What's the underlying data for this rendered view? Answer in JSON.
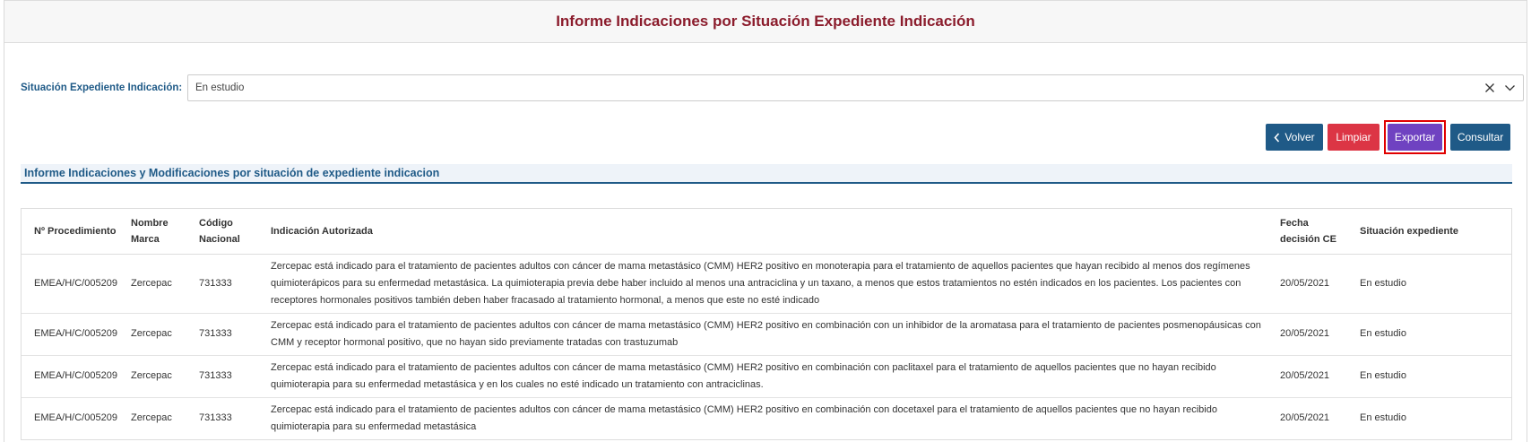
{
  "header": {
    "title": "Informe Indicaciones por Situación Expediente Indicación"
  },
  "filter": {
    "label": "Situación Expediente Indicación:",
    "value": "En estudio",
    "clear_icon": "close-icon",
    "dropdown_icon": "chevron-down-icon"
  },
  "buttons": {
    "volver": "Volver",
    "limpiar": "Limpiar",
    "exportar": "Exportar",
    "consultar": "Consultar"
  },
  "colors": {
    "title": "#8b1c2c",
    "primary": "#1f5a87",
    "danger": "#dc3545",
    "export": "#6f42c1",
    "highlight": "#e00000"
  },
  "section": {
    "heading": "Informe Indicaciones y Modificaciones por situación de expediente indicacion"
  },
  "table": {
    "headers": {
      "procedimiento": "Nº Procedimiento",
      "marca": "Nombre Marca",
      "codigo": "Código Nacional",
      "indicacion": "Indicación Autorizada",
      "fecha": "Fecha decisión CE",
      "situacion": "Situación expediente"
    },
    "rows": [
      {
        "procedimiento": "EMEA/H/C/005209",
        "marca": "Zercepac",
        "codigo": "731333",
        "indicacion": "Zercepac está indicado para el tratamiento de pacientes adultos con cáncer de mama metastásico (CMM) HER2 positivo en monoterapia para el tratamiento de aquellos pacientes que hayan recibido al menos dos regímenes quimioterápicos para su enfermedad metastásica. La quimioterapia previa debe haber incluido al menos una antraciclina y un taxano, a menos que estos tratamientos no estén indicados en los pacientes. Los pacientes con receptores hormonales positivos también deben haber fracasado al tratamiento hormonal, a menos que este no esté indicado",
        "fecha": "20/05/2021",
        "situacion": "En estudio"
      },
      {
        "procedimiento": "EMEA/H/C/005209",
        "marca": "Zercepac",
        "codigo": "731333",
        "indicacion": "Zercepac está indicado para el tratamiento de pacientes adultos con cáncer de mama metastásico (CMM) HER2 positivo en combinación con un inhibidor de la aromatasa para el tratamiento de pacientes posmenopáusicas con CMM y receptor hormonal positivo, que no hayan sido previamente tratadas con trastuzumab",
        "fecha": "20/05/2021",
        "situacion": "En estudio"
      },
      {
        "procedimiento": "EMEA/H/C/005209",
        "marca": "Zercepac",
        "codigo": "731333",
        "indicacion": "Zercepac está indicado para el tratamiento de pacientes adultos con cáncer de mama metastásico (CMM) HER2 positivo en combinación con paclitaxel para el tratamiento de aquellos pacientes que no hayan recibido quimioterapia para su enfermedad metastásica y en los cuales no esté indicado un tratamiento con antraciclinas.",
        "fecha": "20/05/2021",
        "situacion": "En estudio"
      },
      {
        "procedimiento": "EMEA/H/C/005209",
        "marca": "Zercepac",
        "codigo": "731333",
        "indicacion": "Zercepac está indicado para el tratamiento de pacientes adultos con cáncer de mama metastásico (CMM) HER2 positivo en combinación con docetaxel para el tratamiento de aquellos pacientes que no hayan recibido quimioterapia para su enfermedad metastásica",
        "fecha": "20/05/2021",
        "situacion": "En estudio"
      }
    ]
  }
}
